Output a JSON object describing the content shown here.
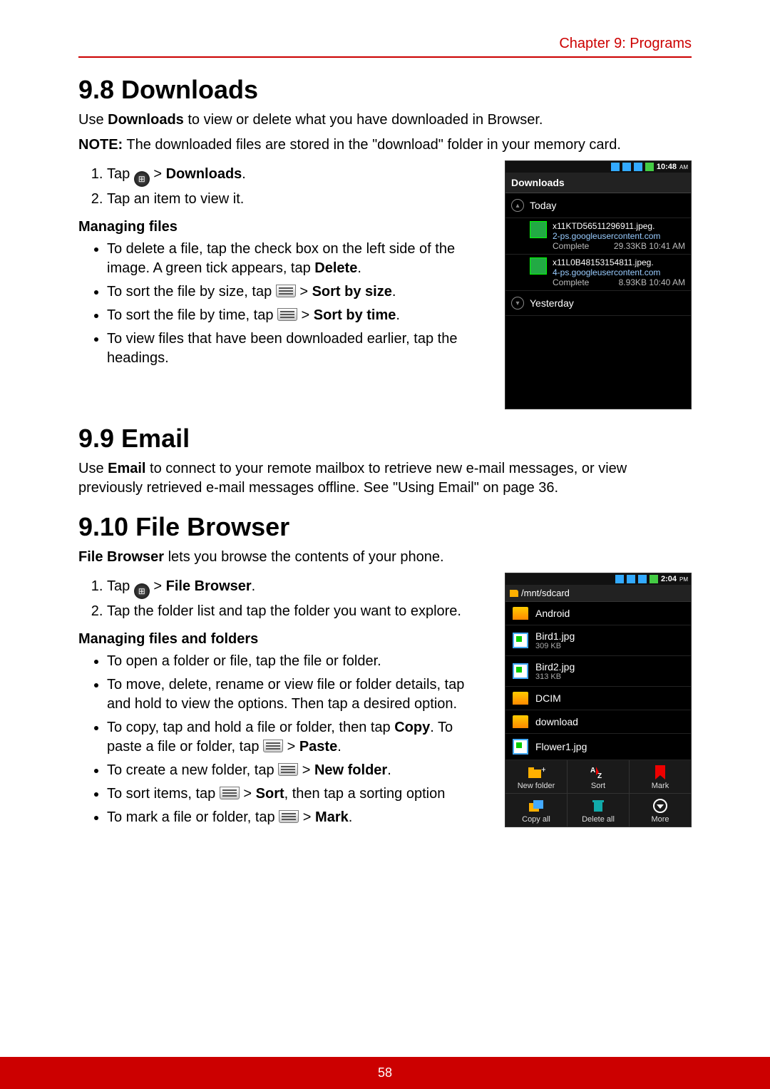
{
  "header": {
    "chapter": "Chapter 9: Programs"
  },
  "s98": {
    "title": "9.8 Downloads",
    "intro_pre": "Use ",
    "intro_bold": "Downloads",
    "intro_post": " to view or delete what you have downloaded in Browser.",
    "note_label": "NOTE:",
    "note_text": " The downloaded files are stored in the \"download\" folder in your memory card.",
    "step1_pre": "Tap ",
    "step1_sep": " > ",
    "step1_bold": "Downloads",
    "step1_dot": ".",
    "step2": "Tap an item to view it.",
    "managing": "Managing files",
    "b1_pre": "To delete a file, tap the check box on the left side of the image. A green tick appears, tap ",
    "b1_bold": "Delete",
    "b1_dot": ".",
    "b2_pre": "To sort the file by size, tap ",
    "b2_sep": " > ",
    "b2_bold": "Sort by size",
    "b2_dot": ".",
    "b3_pre": "To sort the file by time, tap ",
    "b3_sep": " > ",
    "b3_bold": "Sort by time",
    "b3_dot": ".",
    "b4": "To view files that have been downloaded earlier, tap the headings."
  },
  "phone1": {
    "time": "10:48",
    "ampm": "AM",
    "title": "Downloads",
    "groups": [
      "Today",
      "Yesterday"
    ],
    "items": [
      {
        "name": "x11KTD56511296911.jpeg.",
        "source": "2-ps.googleusercontent.com",
        "status": "Complete",
        "size": "29.33KB",
        "when": "10:41 AM"
      },
      {
        "name": "x11L0B48153154811.jpeg.",
        "source": "4-ps.googleusercontent.com",
        "status": "Complete",
        "size": "8.93KB",
        "when": "10:40 AM"
      }
    ]
  },
  "s99": {
    "title": "9.9 Email",
    "p_pre": "Use ",
    "p_bold": "Email",
    "p_post": " to connect to your remote mailbox to retrieve new e-mail messages, or view previously retrieved e-mail messages offline. See \"Using Email\" on page 36."
  },
  "s910": {
    "title": "9.10 File Browser",
    "intro_bold": "File Browser",
    "intro_post": " lets you browse the contents of your phone.",
    "step1_pre": "Tap ",
    "step1_sep": " > ",
    "step1_bold": "File Browser",
    "step1_dot": ".",
    "step2": "Tap the folder list and tap the folder you want to explore.",
    "managing": "Managing files and folders",
    "b1": "To open a folder or file, tap the file or folder.",
    "b2": "To move, delete, rename or view file or folder details, tap and hold to view the options. Then tap a desired option.",
    "b3_pre": "To copy, tap and hold a file or folder, then tap ",
    "b3_bold": "Copy",
    "b3_mid": ". To paste a file or folder, tap ",
    "b3_sep": " > ",
    "b3_bold2": "Paste",
    "b3_dot": ".",
    "b4_pre": "To create a new folder, tap ",
    "b4_sep": " > ",
    "b4_bold": "New folder",
    "b4_dot": ".",
    "b5_pre": "To sort items, tap ",
    "b5_sep": " > ",
    "b5_bold": "Sort",
    "b5_post": ", then tap a sorting option",
    "b6_pre": "To mark a file or folder, tap ",
    "b6_sep": " > ",
    "b6_bold": "Mark",
    "b6_dot": "."
  },
  "phone2": {
    "time": "2:04",
    "ampm": "PM",
    "path": "/mnt/sdcard",
    "items": [
      {
        "name": "Android",
        "type": "folder"
      },
      {
        "name": "Bird1.jpg",
        "type": "image",
        "size": "309 KB"
      },
      {
        "name": "Bird2.jpg",
        "type": "image",
        "size": "313 KB"
      },
      {
        "name": "DCIM",
        "type": "folder"
      },
      {
        "name": "download",
        "type": "folder"
      },
      {
        "name": "Flower1.jpg",
        "type": "image"
      }
    ],
    "buttons": [
      "New folder",
      "Sort",
      "Mark",
      "Copy all",
      "Delete all",
      "More"
    ]
  },
  "footer": {
    "page": "58"
  }
}
